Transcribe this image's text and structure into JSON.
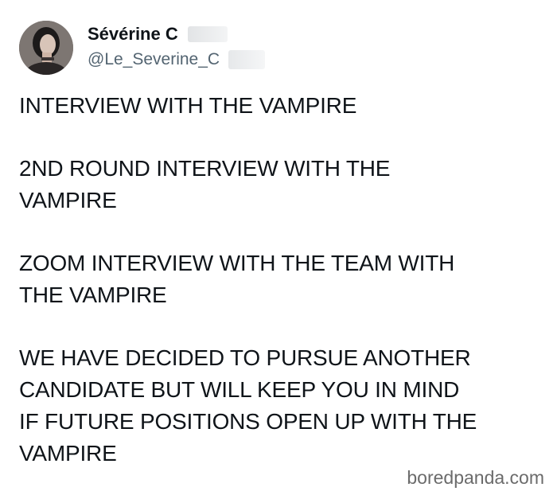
{
  "tweet": {
    "display_name": "Sévérine C",
    "handle": "@Le_Severine_C",
    "avatar_icon": "profile-photo",
    "paragraphs": [
      "INTERVIEW WITH THE VAMPIRE",
      "2ND ROUND INTERVIEW WITH THE\nVAMPIRE",
      "ZOOM INTERVIEW WITH THE TEAM WITH\nTHE VAMPIRE",
      "WE HAVE DECIDED TO PURSUE ANOTHER\nCANDIDATE BUT WILL KEEP YOU IN MIND\nIF FUTURE POSITIONS OPEN UP WITH THE\nVAMPIRE"
    ]
  },
  "watermark": "boredpanda.com"
}
